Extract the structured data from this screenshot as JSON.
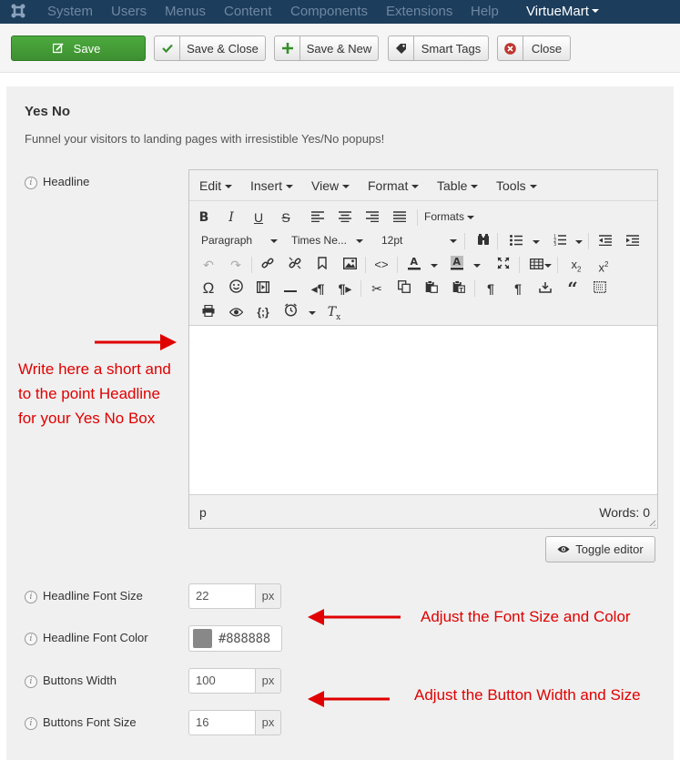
{
  "topnav": {
    "items": [
      "System",
      "Users",
      "Menus",
      "Content",
      "Components",
      "Extensions",
      "Help"
    ],
    "virtuemart": "VirtueMart"
  },
  "toolbar": {
    "save": "Save",
    "save_close": "Save & Close",
    "save_new": "Save & New",
    "smart_tags": "Smart Tags",
    "close": "Close"
  },
  "page": {
    "title": "Yes No",
    "description": "Funnel your visitors to landing pages with irresistible Yes/No popups!"
  },
  "fields": {
    "headline_label": "Headline",
    "headline_font_size_label": "Headline Font Size",
    "headline_font_size_value": "22",
    "headline_font_color_label": "Headline Font Color",
    "headline_font_color_value": "#888888",
    "buttons_width_label": "Buttons Width",
    "buttons_width_value": "100",
    "buttons_font_size_label": "Buttons Font Size",
    "buttons_font_size_value": "16",
    "unit": "px"
  },
  "editor": {
    "menus": [
      "Edit",
      "Insert",
      "View",
      "Format",
      "Table",
      "Tools"
    ],
    "formats_label": "Formats",
    "block_format": "Paragraph",
    "font_family": "Times Ne...",
    "font_size": "12pt",
    "path": "p",
    "words": "Words: 0",
    "toggle_label": "Toggle editor"
  },
  "annotations": {
    "headline_line1": "Write here a short and",
    "headline_line2": "to the point Headline",
    "headline_line3": "for your Yes No Box",
    "font_note": "Adjust the Font Size and Color",
    "button_note": "Adjust the Button Width and Size"
  },
  "colors": {
    "nav_bg": "#1c3d5c",
    "save_green": "#46a23a",
    "annotation_red": "#e00000",
    "swatch": "#888888"
  }
}
